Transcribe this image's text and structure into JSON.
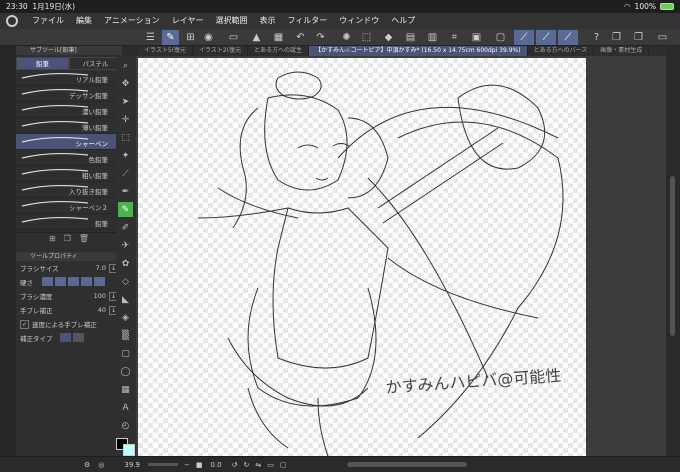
{
  "status": {
    "time": "23:30",
    "date": "1月19日(水)",
    "battery": "100%"
  },
  "menu": [
    "ファイル",
    "編集",
    "アニメーション",
    "レイヤー",
    "選択範囲",
    "表示",
    "フィルター",
    "ウィンドウ",
    "ヘルプ"
  ],
  "tabs": [
    "イラスト5(復元",
    "イラスト2(復元",
    "とある方への誕生",
    "【かすみん☆コートピア】中須かすみ* (16.50 x 14.75cm 600dpi 39.9%)",
    "とある方へのバース",
    "画像・素材生成"
  ],
  "subtool": {
    "title": "サブツール[鉛筆]",
    "tab_pencil": "鉛筆",
    "tab_pastel": "パステル",
    "brushes": [
      "リアル鉛筆",
      "デッサン鉛筆",
      "濃い鉛筆",
      "薄い鉛筆",
      "シャーペン",
      "色鉛筆",
      "粗い鉛筆",
      "入り抜き鉛筆",
      "シャーペン２",
      "鉛筆"
    ],
    "active_index": 4
  },
  "toolprop": {
    "title": "ツールプロパティ",
    "brush_size_label": "ブラシサイズ",
    "brush_size": "7.0",
    "hardness_label": "硬さ",
    "density_label": "ブラシ濃度",
    "density": "100",
    "stabilizer_label": "手ブレ補正",
    "stabilizer": "40",
    "speed_label": "速度による手ブレ補正",
    "correction_label": "補正タイプ"
  },
  "bottom": {
    "zoom": "39.9",
    "angle": "0.0"
  },
  "canvas_text": "かすみんハピバ@可能性"
}
